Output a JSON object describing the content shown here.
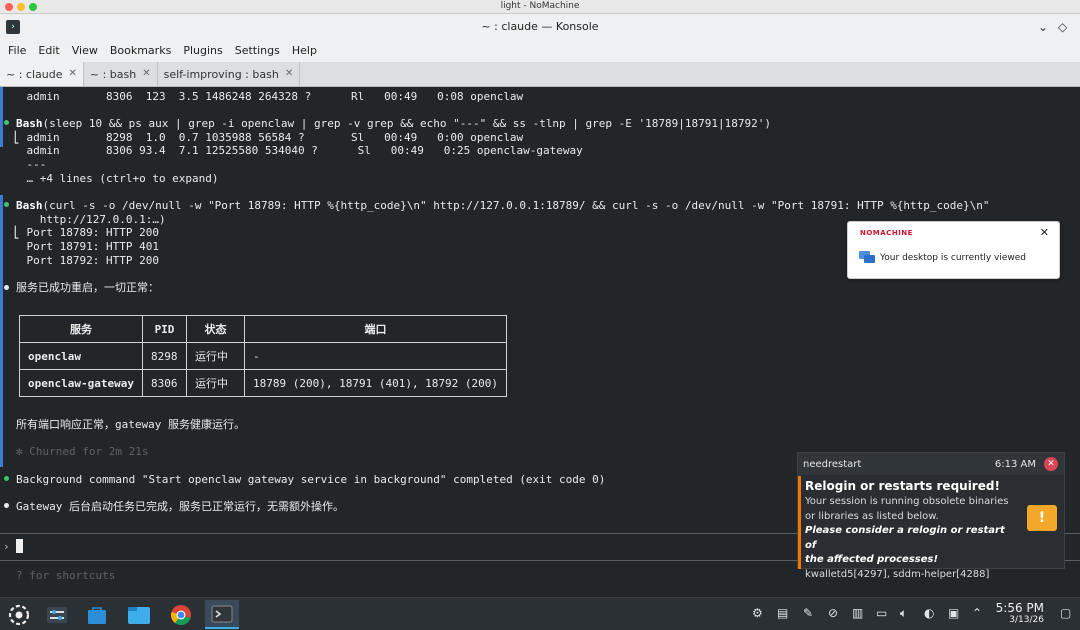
{
  "mac_window": {
    "title": "light - NoMachine",
    "lights": [
      "#fe5f57",
      "#febc2e",
      "#28c840"
    ]
  },
  "konsole": {
    "title": "~ : claude — Konsole",
    "menu": [
      "File",
      "Edit",
      "View",
      "Bookmarks",
      "Plugins",
      "Settings",
      "Help"
    ],
    "tabs": [
      {
        "label": "~ : claude",
        "close": "✕"
      },
      {
        "label": "~ : bash",
        "close": "✕"
      },
      {
        "label": "self-improving : bash",
        "close": "✕"
      }
    ]
  },
  "terminal": {
    "l1": "    admin       8306  123  3.5 1486248 264328 ?      Rl   00:49   0:08 openclaw",
    "cmd1_tool": "Bash",
    "cmd1_args": "(sleep 10 && ps aux | grep -i openclaw | grep -v grep && echo \"---\" && ss -tlnp | grep -E '18789|18791|18792')",
    "o1a": "  ⎣ admin       8298  1.0  0.7 1035988 56584 ?       Sl   00:49   0:00 openclaw",
    "o1b": "    admin       8306 93.4  7.1 12525580 534040 ?      Sl   00:49   0:25 openclaw-gateway",
    "o1c": "    ---",
    "o1d": "    … +4 lines (ctrl+o to expand)",
    "cmd2_tool": "Bash",
    "cmd2_args": "(curl -s -o /dev/null -w \"Port 18789: HTTP %{http_code}\\n\" http://127.0.0.1:18789/ && curl -s -o /dev/null -w \"Port 18791: HTTP %{http_code}\\n\"",
    "cmd2_cont": "      http://127.0.0.1:…)",
    "o2a": "  ⎣ Port 18789: HTTP 200",
    "o2b": "    Port 18791: HTTP 401",
    "o2c": "    Port 18792: HTTP 200",
    "restart_msg": "服务已成功重启，一切正常：",
    "table": {
      "headers": [
        "服务",
        "PID",
        "状态",
        "端口"
      ],
      "rows": [
        [
          "openclaw",
          "8298",
          "运行中",
          "-"
        ],
        [
          "openclaw-gateway",
          "8306",
          "运行中",
          "18789 (200), 18791 (401), 18792 (200)"
        ]
      ]
    },
    "ports_ok": "所有端口响应正常，gateway 服务健康运行。",
    "churned": "✻ Churned for 2m 21s",
    "bg_done": "Background command \"Start openclaw gateway service in background\" completed (exit code 0)",
    "gateway_done": "Gateway 后台启动任务已完成，服务已正常运行，无需额外操作。",
    "prompt": "›",
    "shortcuts": "? for shortcuts"
  },
  "nomachine_popup": {
    "brand": "NOMACHINE",
    "close": "✕",
    "message": "Your desktop is currently viewed"
  },
  "needrestart": {
    "app": "needrestart",
    "time": "6:13 AM",
    "heading": "Relogin or restarts required!",
    "line1": "Your session is running obsolete binaries",
    "line2": "or libraries as listed below.",
    "line3": "Please consider a relogin or restart of",
    "line4": "the affected processes!",
    "line5": "kwalletd5[4297], sddm-helper[4288]"
  },
  "taskbar": {
    "time": "5:56 PM",
    "date": "3/13/26"
  },
  "colors": {
    "accent_blue": "#3daee9",
    "green_bullet": "#3ec46d",
    "warning_orange": "#f67400"
  }
}
